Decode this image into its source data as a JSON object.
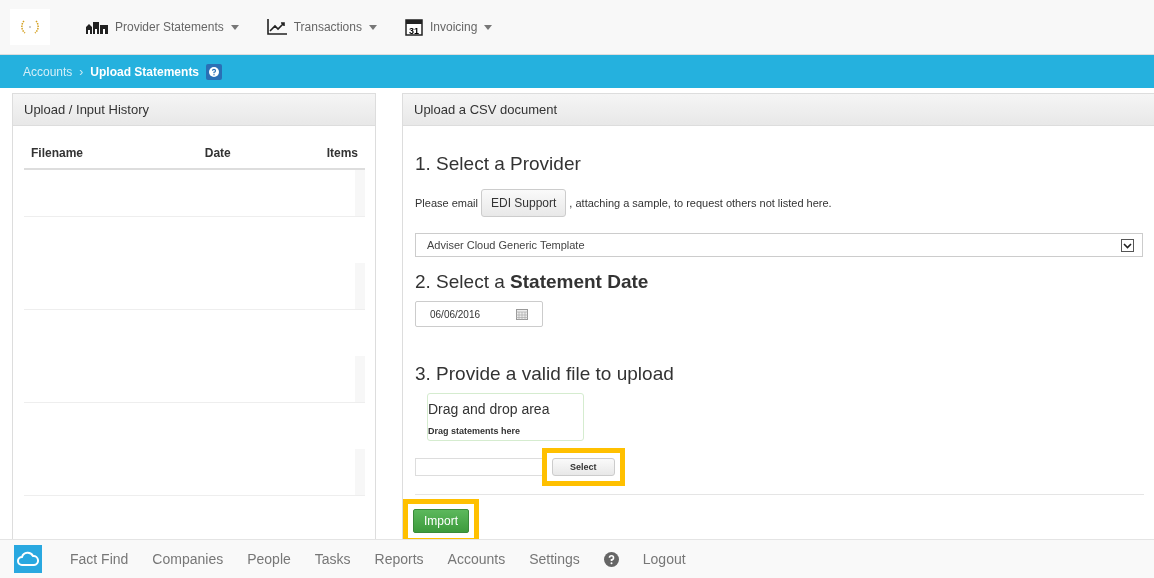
{
  "nav": {
    "items": [
      {
        "label": "Provider Statements",
        "kind": "buildings"
      },
      {
        "label": "Transactions",
        "kind": "chart"
      },
      {
        "label": "Invoicing",
        "kind": "calendar",
        "icon_text": "31"
      }
    ]
  },
  "breadcrumb": {
    "items": [
      "Accounts",
      "Upload Statements"
    ],
    "separator": "›"
  },
  "history": {
    "title": "Upload / Input History",
    "columns": [
      "Filename",
      "Date",
      "Items"
    ]
  },
  "upload": {
    "title": "Upload a CSV document",
    "step1": {
      "heading": "1. Select a Provider",
      "note_before": "Please email",
      "support_button": "EDI Support",
      "note_after": ", attaching a sample, to request others not listed here.",
      "provider": "Adviser Cloud Generic Template"
    },
    "step2": {
      "heading": "2. Select a **Statement Date**",
      "date": "06/06/2016"
    },
    "step3": {
      "heading": "3. Provide a valid file to upload",
      "drop_title": "Drag and drop area",
      "drop_hint": "Drag statements here",
      "select_button": "Select",
      "select_highlighted": true
    },
    "import_button": "Import",
    "import_highlighted": true
  },
  "footer": {
    "items": [
      "Fact Find",
      "Companies",
      "People",
      "Tasks",
      "Reports",
      "Accounts",
      "Settings",
      "Logout"
    ]
  }
}
